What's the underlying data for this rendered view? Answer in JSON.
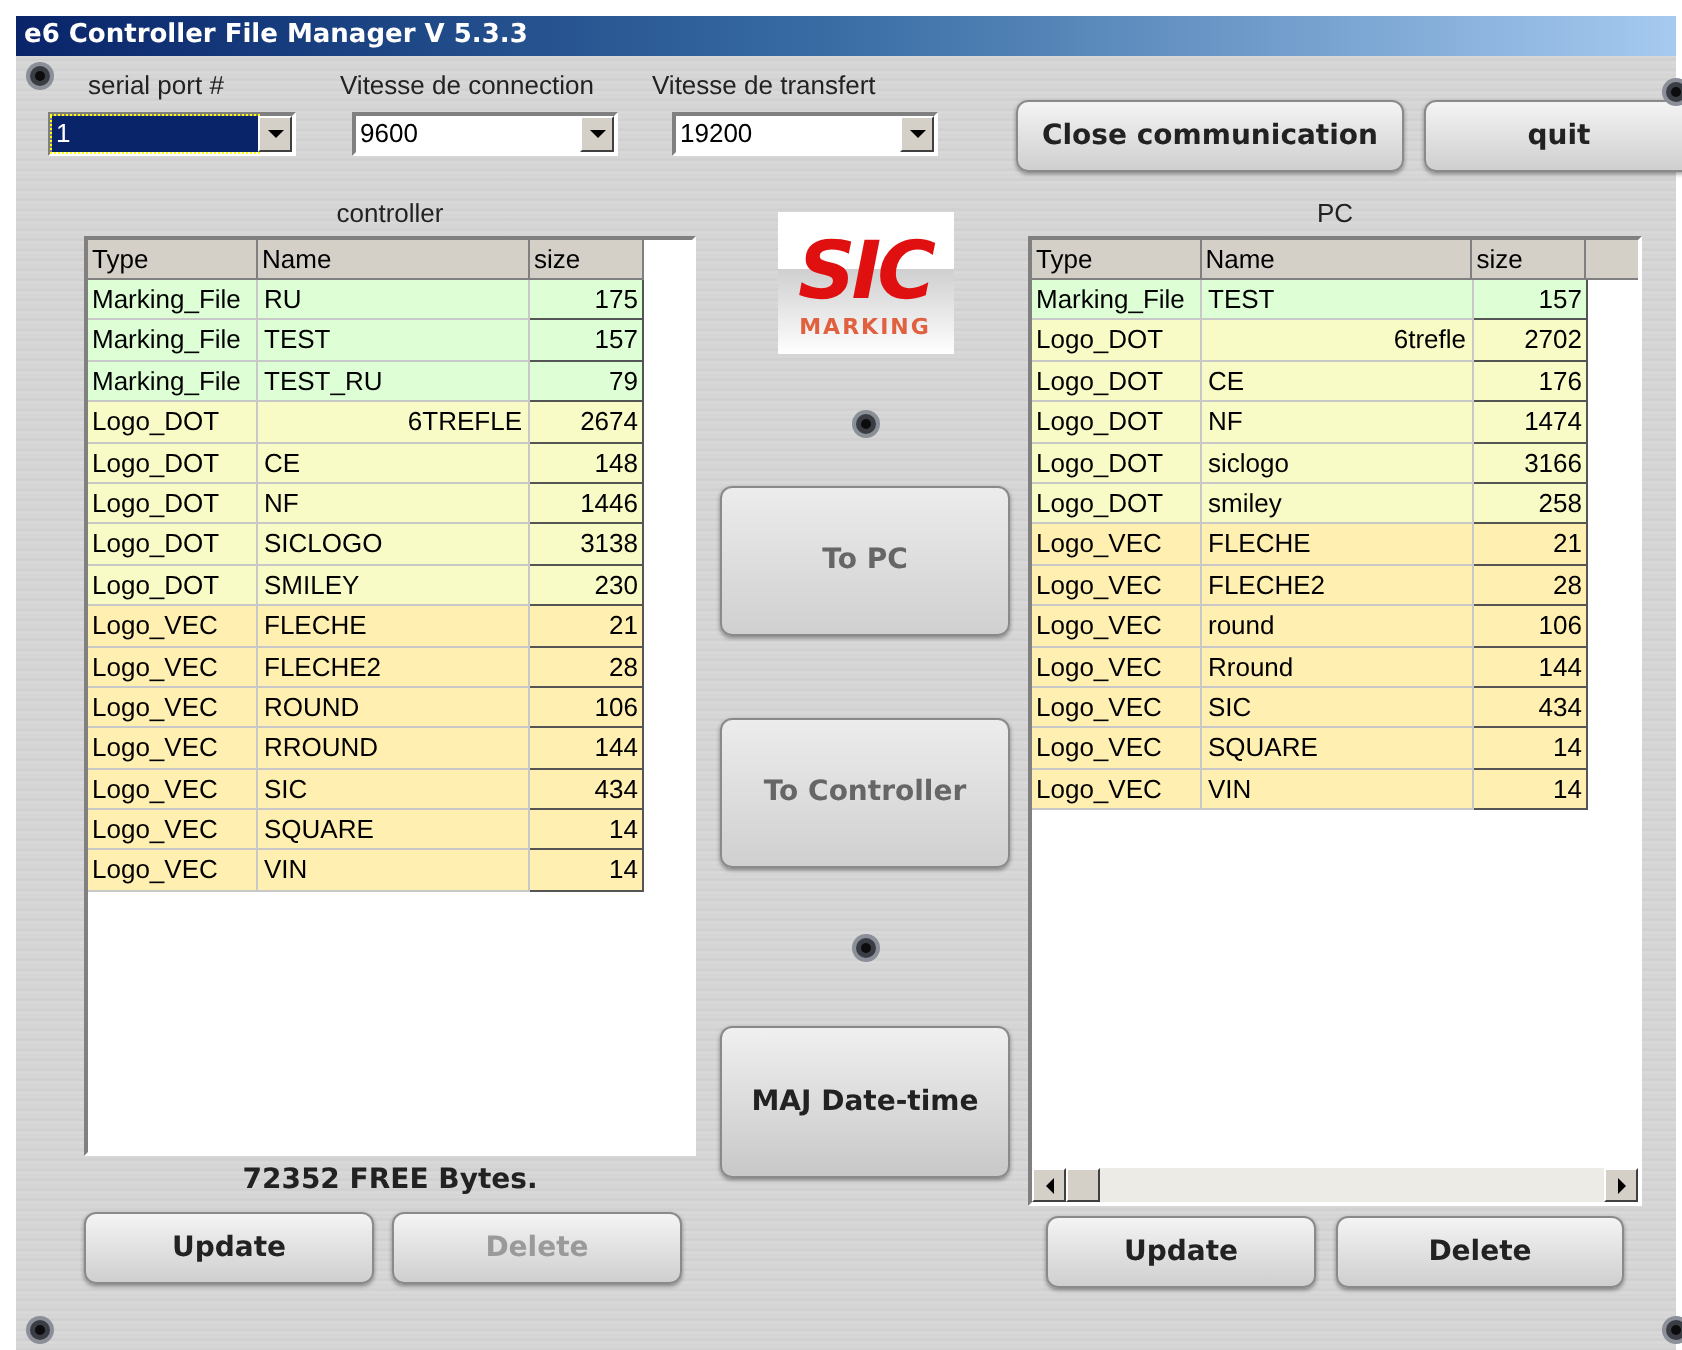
{
  "window": {
    "title": "e6 Controller File Manager V 5.3.3"
  },
  "combos": [
    {
      "label": "serial port #",
      "value": "1",
      "focused": true
    },
    {
      "label": "Vitesse de connection",
      "value": "9600",
      "focused": false
    },
    {
      "label": "Vitesse de transfert",
      "value": "19200",
      "focused": false
    }
  ],
  "top_buttons": [
    {
      "label": "Close communication",
      "disabled": false
    },
    {
      "label": "quit",
      "disabled": false
    }
  ],
  "logo": {
    "main": "SIC",
    "sub": "MARKING"
  },
  "controller": {
    "title": "controller",
    "columns": [
      "Type",
      "Name",
      "size"
    ],
    "rows": [
      {
        "type": "Marking_File",
        "name": "RU",
        "size": "175",
        "color": "#deffd6",
        "name_right": false
      },
      {
        "type": "Marking_File",
        "name": "TEST",
        "size": "157",
        "color": "#deffd6",
        "name_right": false
      },
      {
        "type": "Marking_File",
        "name": "TEST_RU",
        "size": "79",
        "color": "#deffd6",
        "name_right": false
      },
      {
        "type": "Logo_DOT",
        "name": "6TREFLE",
        "size": "2674",
        "color": "#f8fbc6",
        "name_right": true
      },
      {
        "type": "Logo_DOT",
        "name": "CE",
        "size": "148",
        "color": "#f8fbc6",
        "name_right": false
      },
      {
        "type": "Logo_DOT",
        "name": "NF",
        "size": "1446",
        "color": "#f8fbc6",
        "name_right": false
      },
      {
        "type": "Logo_DOT",
        "name": "SICLOGO",
        "size": "3138",
        "color": "#f8fbc6",
        "name_right": false
      },
      {
        "type": "Logo_DOT",
        "name": "SMILEY",
        "size": "230",
        "color": "#f8fbc6",
        "name_right": false
      },
      {
        "type": "Logo_VEC",
        "name": "FLECHE",
        "size": "21",
        "color": "#ffefb0",
        "name_right": false
      },
      {
        "type": "Logo_VEC",
        "name": "FLECHE2",
        "size": "28",
        "color": "#ffefb0",
        "name_right": false
      },
      {
        "type": "Logo_VEC",
        "name": "ROUND",
        "size": "106",
        "color": "#ffefb0",
        "name_right": false
      },
      {
        "type": "Logo_VEC",
        "name": "RROUND",
        "size": "144",
        "color": "#ffefb0",
        "name_right": false
      },
      {
        "type": "Logo_VEC",
        "name": "SIC",
        "size": "434",
        "color": "#ffefb0",
        "name_right": false
      },
      {
        "type": "Logo_VEC",
        "name": "SQUARE",
        "size": "14",
        "color": "#ffefb0",
        "name_right": false
      },
      {
        "type": "Logo_VEC",
        "name": "VIN",
        "size": "14",
        "color": "#ffefb0",
        "name_right": false
      }
    ],
    "free": "72352 FREE Bytes.",
    "buttons": [
      {
        "label": "Update",
        "disabled": false
      },
      {
        "label": "Delete",
        "disabled": true
      }
    ]
  },
  "middle_buttons": [
    {
      "label": "To PC",
      "disabled": true
    },
    {
      "label": "To Controller",
      "disabled": true
    },
    {
      "label": "MAJ Date-time",
      "disabled": false
    }
  ],
  "pc": {
    "title": "PC",
    "columns": [
      "Type",
      "Name",
      "size"
    ],
    "rows": [
      {
        "type": "Marking_File",
        "name": "TEST",
        "size": "157",
        "color": "#deffd6",
        "name_right": false
      },
      {
        "type": "Logo_DOT",
        "name": "6trefle",
        "size": "2702",
        "color": "#f8fbc6",
        "name_right": true
      },
      {
        "type": "Logo_DOT",
        "name": "CE",
        "size": "176",
        "color": "#f8fbc6",
        "name_right": false
      },
      {
        "type": "Logo_DOT",
        "name": "NF",
        "size": "1474",
        "color": "#f8fbc6",
        "name_right": false
      },
      {
        "type": "Logo_DOT",
        "name": "siclogo",
        "size": "3166",
        "color": "#f8fbc6",
        "name_right": false
      },
      {
        "type": "Logo_DOT",
        "name": "smiley",
        "size": "258",
        "color": "#f8fbc6",
        "name_right": false
      },
      {
        "type": "Logo_VEC",
        "name": "FLECHE",
        "size": "21",
        "color": "#ffefb0",
        "name_right": false
      },
      {
        "type": "Logo_VEC",
        "name": "FLECHE2",
        "size": "28",
        "color": "#ffefb0",
        "name_right": false
      },
      {
        "type": "Logo_VEC",
        "name": "round",
        "size": "106",
        "color": "#ffefb0",
        "name_right": false
      },
      {
        "type": "Logo_VEC",
        "name": "Rround",
        "size": "144",
        "color": "#ffefb0",
        "name_right": false
      },
      {
        "type": "Logo_VEC",
        "name": "SIC",
        "size": "434",
        "color": "#ffefb0",
        "name_right": false
      },
      {
        "type": "Logo_VEC",
        "name": "SQUARE",
        "size": "14",
        "color": "#ffefb0",
        "name_right": false
      },
      {
        "type": "Logo_VEC",
        "name": "VIN",
        "size": "14",
        "color": "#ffefb0",
        "name_right": false
      }
    ],
    "buttons": [
      {
        "label": "Update",
        "disabled": false
      },
      {
        "label": "Delete",
        "disabled": false
      }
    ]
  }
}
